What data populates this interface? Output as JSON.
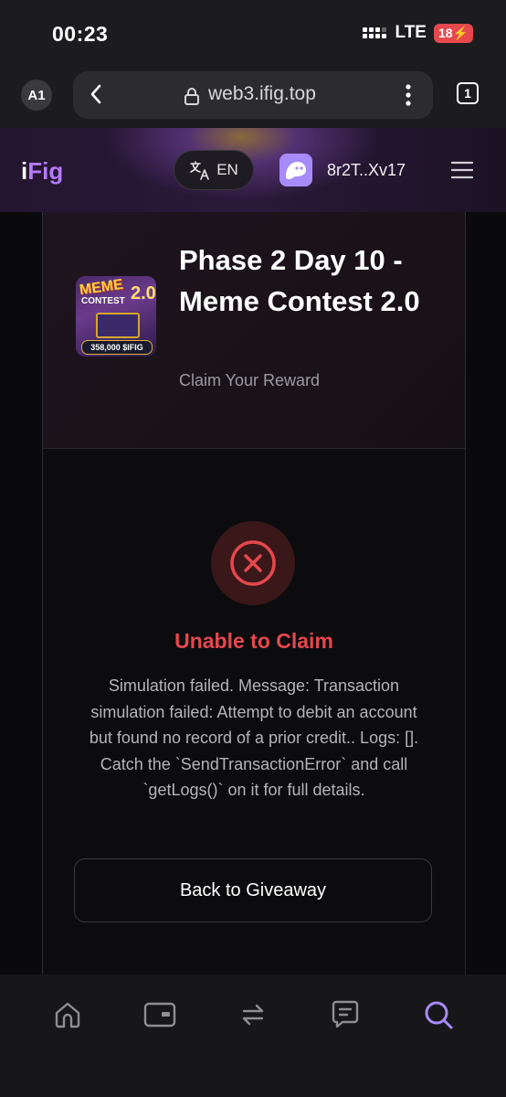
{
  "status_bar": {
    "time": "00:23",
    "network": "LTE",
    "battery": "18"
  },
  "browser": {
    "profile": "A1",
    "url": "web3.ifig.top",
    "tab_count": "1"
  },
  "header": {
    "logo_i": "i",
    "logo_fig": "Fig",
    "language": "EN",
    "wallet_address": "8r2T..Xv17",
    "colors": {
      "accent": "#b57bff",
      "wallet": "#a78bfa"
    }
  },
  "card": {
    "title": "Phase 2 Day 10 - Meme Contest 2.0",
    "subtitle": "Claim Your Reward",
    "thumbnail": {
      "line1": "MEME",
      "line2": "CONTEST",
      "version": "2.0",
      "prize": "358,000 $IFIG"
    },
    "error": {
      "title": "Unable to Claim",
      "message": "Simulation failed. Message: Transaction simulation failed: Attempt to debit an account but found no record of a prior credit.. Logs: []. Catch the `SendTransactionError` and call `getLogs()` on it for full details.",
      "color": "#e5484d"
    },
    "back_button": "Back to Giveaway"
  },
  "bottom_nav": {
    "items": [
      {
        "icon": "home-icon"
      },
      {
        "icon": "wallet-card-icon"
      },
      {
        "icon": "swap-icon"
      },
      {
        "icon": "chat-icon"
      },
      {
        "icon": "search-icon",
        "active": true
      }
    ],
    "active_color": "#a78bfa"
  }
}
